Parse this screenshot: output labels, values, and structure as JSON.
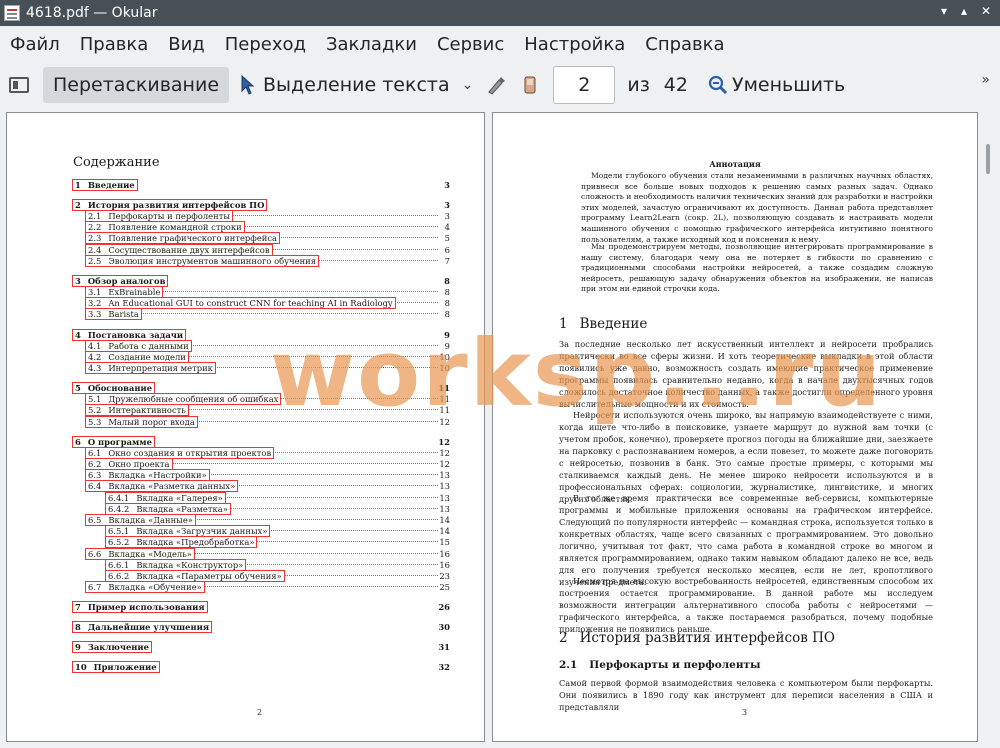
{
  "window": {
    "title": "4618.pdf  — Okular",
    "controls": [
      "▾",
      "▴",
      "✕"
    ]
  },
  "menu": [
    "Файл",
    "Правка",
    "Вид",
    "Переход",
    "Закладки",
    "Сервис",
    "Настройка",
    "Справка"
  ],
  "toolbar": {
    "pan_label": "Перетаскивание",
    "select_label": "Выделение текста",
    "page_value": "2",
    "of_label": "из",
    "total_pages": "42",
    "zoom_out_label": "Уменьшить",
    "more": "»"
  },
  "left_page": {
    "toc_title": "Содержание",
    "page_number": "2",
    "entries": [
      {
        "num": "1",
        "title": "Введение",
        "page": "3",
        "level": 0
      },
      {
        "num": "2",
        "title": "История развития интерфейсов ПО",
        "page": "3",
        "level": 0
      },
      {
        "num": "2.1",
        "title": "Перфокарты и перфоленты",
        "page": "3",
        "level": 1
      },
      {
        "num": "2.2",
        "title": "Появление командной строки",
        "page": "4",
        "level": 1
      },
      {
        "num": "2.3",
        "title": "Появление графического интерфейса",
        "page": "5",
        "level": 1
      },
      {
        "num": "2.4",
        "title": "Сосуществование двух интерфейсов",
        "page": "6",
        "level": 1
      },
      {
        "num": "2.5",
        "title": "Эволюция инструментов машинного обучения",
        "page": "7",
        "level": 1
      },
      {
        "num": "3",
        "title": "Обзор аналогов",
        "page": "8",
        "level": 0
      },
      {
        "num": "3.1",
        "title": "ExBrainable",
        "page": "8",
        "level": 1
      },
      {
        "num": "3.2",
        "title": "An Educational GUI to construct CNN for teaching AI in Radiology",
        "page": "8",
        "level": 1
      },
      {
        "num": "3.3",
        "title": "Barista",
        "page": "8",
        "level": 1
      },
      {
        "num": "4",
        "title": "Постановка задачи",
        "page": "9",
        "level": 0
      },
      {
        "num": "4.1",
        "title": "Работа с данными",
        "page": "9",
        "level": 1
      },
      {
        "num": "4.2",
        "title": "Создание модели",
        "page": "10",
        "level": 1
      },
      {
        "num": "4.3",
        "title": "Интерпретация метрик",
        "page": "10",
        "level": 1
      },
      {
        "num": "5",
        "title": "Обоснование",
        "page": "11",
        "level": 0
      },
      {
        "num": "5.1",
        "title": "Дружелюбные сообщения об ошибках",
        "page": "11",
        "level": 1
      },
      {
        "num": "5.2",
        "title": "Интерактивность",
        "page": "11",
        "level": 1
      },
      {
        "num": "5.3",
        "title": "Малый порог входа",
        "page": "12",
        "level": 1
      },
      {
        "num": "6",
        "title": "О программе",
        "page": "12",
        "level": 0
      },
      {
        "num": "6.1",
        "title": "Окно создания и открытия проектов",
        "page": "12",
        "level": 1
      },
      {
        "num": "6.2",
        "title": "Окно проекта",
        "page": "12",
        "level": 1
      },
      {
        "num": "6.3",
        "title": "Вкладка «Настройки»",
        "page": "13",
        "level": 1
      },
      {
        "num": "6.4",
        "title": "Вкладка «Разметка данных»",
        "page": "13",
        "level": 1
      },
      {
        "num": "6.4.1",
        "title": "Вкладка «Галерея»",
        "page": "13",
        "level": 2
      },
      {
        "num": "6.4.2",
        "title": "Вкладка «Разметка»",
        "page": "13",
        "level": 2
      },
      {
        "num": "6.5",
        "title": "Вкладка «Данные»",
        "page": "14",
        "level": 1
      },
      {
        "num": "6.5.1",
        "title": "Вкладка «Загрузчик данных»",
        "page": "14",
        "level": 2
      },
      {
        "num": "6.5.2",
        "title": "Вкладка «Предобработка»",
        "page": "15",
        "level": 2
      },
      {
        "num": "6.6",
        "title": "Вкладка «Модель»",
        "page": "16",
        "level": 1
      },
      {
        "num": "6.6.1",
        "title": "Вкладка «Конструктор»",
        "page": "16",
        "level": 2
      },
      {
        "num": "6.6.2",
        "title": "Вкладка «Параметры обучения»",
        "page": "23",
        "level": 2
      },
      {
        "num": "6.7",
        "title": "Вкладка «Обучение»",
        "page": "25",
        "level": 1
      },
      {
        "num": "7",
        "title": "Пример использования",
        "page": "26",
        "level": 0
      },
      {
        "num": "8",
        "title": "Дальнейшие улучшения",
        "page": "30",
        "level": 0
      },
      {
        "num": "9",
        "title": "Заключение",
        "page": "31",
        "level": 0
      },
      {
        "num": "10",
        "title": "Приложение",
        "page": "32",
        "level": 0
      }
    ]
  },
  "right_page": {
    "page_number": "3",
    "abstract_title": "Аннотация",
    "abstract_p1": "Модели глубокого обучения стали незаменимыми в различных научных областях, привнеся все больше новых подходов к решению самых разных задач. Однако сложность и необходимость наличия технических знаний для разработки и настройки этих моделей, зачастую ограничивают их доступность. Данная работа представляет программу Learn2Learn (сокр. 2L), позволяющую создавать и настраивать модели машинного обучения с помощью графического интерфейса интуитивно понятного пользователям, а также исходный код и пояснения к нему.",
    "abstract_p2": "Мы продемонстрируем методы, позволяющие интегрировать программирование в нашу систему, благодаря чему она не потеряет в гибкости по сравнению с традиционными способами настройки нейросетей, а также создадим сложную нейросеть, решающую задачу обнаружения объектов на изображении, не написав при этом ни единой строчки кода.",
    "h1_num": "1",
    "h1_title": "Введение",
    "intro_p1": "За последние несколько лет искусственный интеллект и нейросети пробрались практически во все сферы жизни. И хоть теоретические выкладки в этой области появились уже давно, возможность создать имеющие практическое применение программы появилась сравнительно недавно, когда в начале двухтысячных годов сложилось достаточное количество данных, а также достигли определенного уровня вычислительные мощности и их стоимость.",
    "intro_p2": "Нейросети используются очень широко, вы напрямую взаимодействуете с ними, когда ищете что-либо в поисковике, узнаете маршрут до нужной вам точки (с учетом пробок, конечно), проверяете прогноз погоды на ближайшие дни, заезжаете на парковку с распознаванием номеров, а если повезет, то можете даже поговорить с нейросетью, позвонив в банк. Это самые простые примеры, с которыми мы сталкиваемся каждый день. Не менее широко нейросети используются и в профессиональных сферах: социологии, журналистике, лингвистике, и многих других областях.",
    "intro_p3": "В то же время практически все современные веб-сервисы, компьютерные программы и мобильные приложения основаны на графическом интерфейсе. Следующий по популярности интерфейс — командная строка, используется только в конкретных областях, чаще всего связанных с программированием. Это довольно логично, учитывая тот факт, что сама работа в командной строке во многом и является программированием, однако таким навыком обладают далеко не все, ведь для его получения требуется несколько месяцев, если не лет, кропотливого изучения предмета.",
    "intro_p4": "Несмотря на высокую востребованность нейросетей, единственным способом их построения остается программирование. В данной работе мы исследуем возможности интеграции альтернативного способа работы с нейросетями — графического интерфейса, а также постараемся разобраться, почему подобные приложения не появились раньше.",
    "h1b_num": "2",
    "h1b_title": "История развития интерфейсов ПО",
    "h2_num": "2.1",
    "h2_title": "Перфокарты и перфоленты",
    "punch_p": "Самой первой формой взаимодействия человека с компьютером были перфокарты. Они появились в 1890 году как инструмент для переписи населения в США и представляли"
  },
  "watermark": "worksp...ru"
}
